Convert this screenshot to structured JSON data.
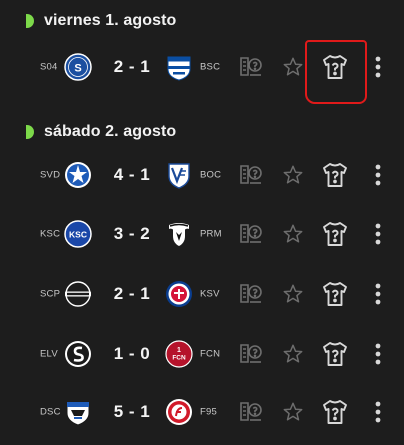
{
  "days": [
    {
      "title": "viernes 1. agosto",
      "matches": [
        {
          "home": "S04",
          "away": "BSC",
          "score": "2 - 1",
          "home_crest": "schalke-crest",
          "away_crest": "hertha-crest"
        }
      ]
    },
    {
      "title": "sábado 2. agosto",
      "matches": [
        {
          "home": "SVD",
          "away": "BOC",
          "score": "4 - 1",
          "home_crest": "darmstadt-crest",
          "away_crest": "bochum-crest"
        },
        {
          "home": "KSC",
          "away": "PRM",
          "score": "3 - 2",
          "home_crest": "karlsruhe-crest",
          "away_crest": "preussen-muenster-crest"
        },
        {
          "home": "SCP",
          "away": "KSV",
          "score": "2 - 1",
          "home_crest": "paderborn-crest",
          "away_crest": "kiel-crest"
        },
        {
          "home": "ELV",
          "away": "FCN",
          "score": "1 - 0",
          "home_crest": "elversberg-crest",
          "away_crest": "nuernberg-crest"
        },
        {
          "home": "DSC",
          "away": "F95",
          "score": "5 - 1",
          "home_crest": "bielefeld-crest",
          "away_crest": "duesseldorf-crest"
        }
      ]
    }
  ],
  "crest_texts": {
    "ksc": "KSC",
    "fcn": "FCN",
    "fcn_num": "1"
  },
  "colors": {
    "background": "#1d1d1d",
    "day_marker": "#7dd94a",
    "icon_muted": "#6e6e6e",
    "icon_bright": "#d8d8d8",
    "annotation": "#e01a1a"
  },
  "row_icons": [
    "prediction-board-icon",
    "star-icon",
    "shirt-question-icon",
    "more-vertical-icon"
  ]
}
